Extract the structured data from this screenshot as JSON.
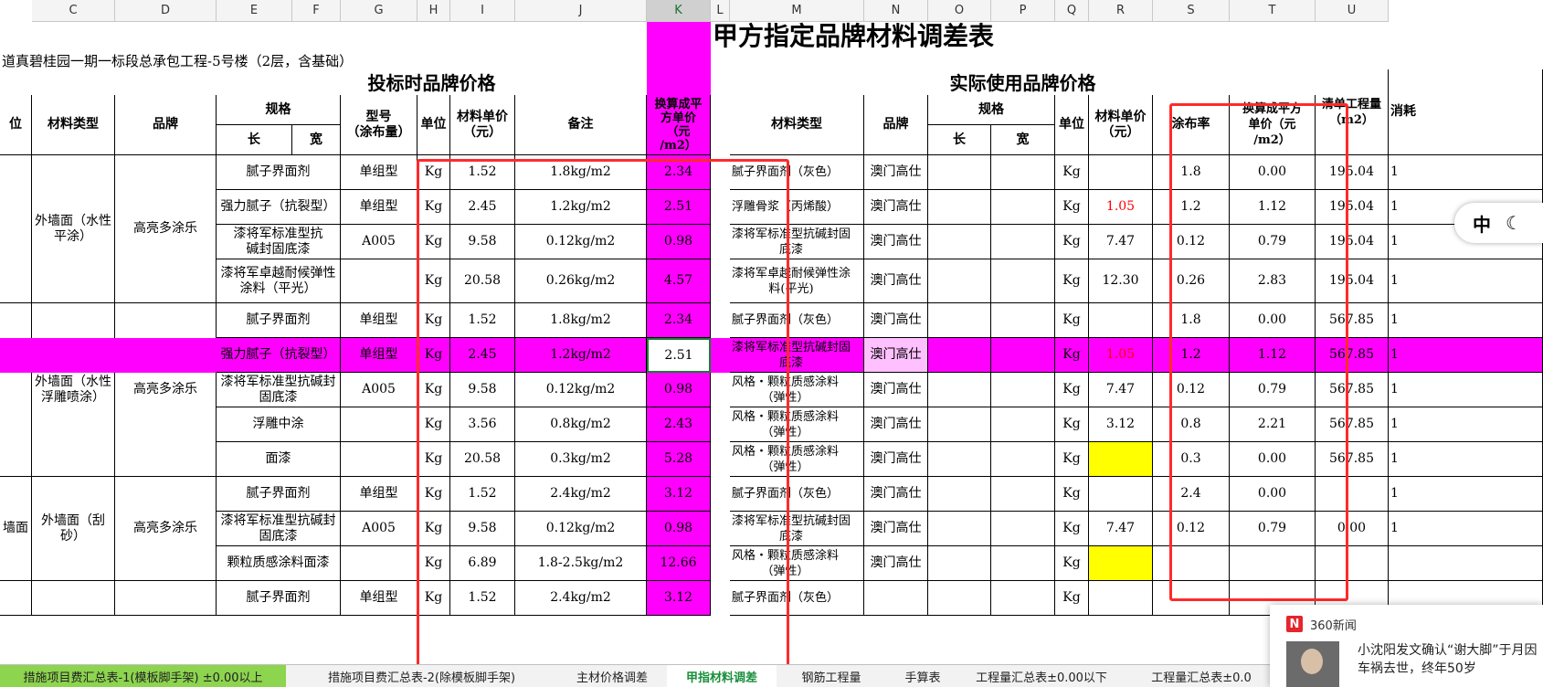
{
  "sheet": {
    "title": "甲方指定品牌材料调差表",
    "project": "道真碧桂园一期一标段总承包工程-5号楼（2层，含基础）",
    "section_left": "投标时品牌价格",
    "section_right": "实际使用品牌价格"
  },
  "column_letters": [
    "C",
    "D",
    "E",
    "F",
    "G",
    "H",
    "I",
    "J",
    "K",
    "L",
    "M",
    "N",
    "O",
    "P",
    "Q",
    "R",
    "S",
    "T",
    "U"
  ],
  "header": {
    "left_cut": "位",
    "material_type": "材料类型",
    "brand": "品牌",
    "spec": "规格",
    "length": "长",
    "width": "宽",
    "model": "型号\n（涂布量）",
    "unit": "单位",
    "unit_price": "材料单价\n（元）",
    "remark": "备注",
    "convert": "换算成平\n方单价\n（元\n/m2）",
    "coat_rate": "涂布率",
    "convert_r": "换算成平方\n单价（元\n/m2）",
    "quantity": "清单工程量\n（m2）",
    "consume_cut": "消耗"
  },
  "groups": [
    {
      "c": "",
      "material": "外墙面（水性\n平涂）",
      "brand": "高亮多涂乐"
    },
    {
      "c": "",
      "material": "外墙面（水性\n浮雕喷涂）",
      "brand": "高亮多涂乐"
    },
    {
      "c": "墙面",
      "material": "外墙面（刮\n砂）",
      "brand": "高亮多涂乐"
    }
  ],
  "rows": [
    {
      "e": "腻子界面剂",
      "g": "单组型",
      "h": "Kg",
      "i": "1.52",
      "j": "1.8kg/m2",
      "k": "2.34",
      "m": "腻子界面剂（灰色）",
      "n": "澳门高仕",
      "q": "Kg",
      "r": "",
      "s": "1.8",
      "t": "0.00",
      "u": "195.04",
      "v": "1"
    },
    {
      "e": "强力腻子（抗裂型）",
      "g": "单组型",
      "h": "Kg",
      "i": "2.45",
      "j": "1.2kg/m2",
      "k": "2.51",
      "m": "浮雕骨浆（丙烯酸）",
      "n": "澳门高仕",
      "q": "Kg",
      "r": "1.05",
      "s": "1.2",
      "t": "1.12",
      "u": "195.04",
      "v": "1"
    },
    {
      "e": "漆将军标准型抗\n碱封固底漆",
      "g": "A005",
      "h": "Kg",
      "i": "9.58",
      "j": "0.12kg/m2",
      "k": "0.98",
      "m": "漆将军标准型抗碱封固\n底漆",
      "n": "澳门高仕",
      "q": "Kg",
      "r": "7.47",
      "s": "0.12",
      "t": "0.79",
      "u": "195.04",
      "v": "1"
    },
    {
      "e": "漆将军卓越耐候弹性\n涂料（平光）",
      "g": "",
      "h": "Kg",
      "i": "20.58",
      "j": "0.26kg/m2",
      "k": "4.57",
      "m": "漆将军卓越耐候弹性涂\n料(平光)",
      "n": "澳门高仕",
      "q": "Kg",
      "r": "12.30",
      "s": "0.26",
      "t": "2.83",
      "u": "195.04",
      "v": "1"
    },
    {
      "e": "腻子界面剂",
      "g": "单组型",
      "h": "Kg",
      "i": "1.52",
      "j": "1.8kg/m2",
      "k": "2.34",
      "m": "腻子界面剂（灰色）",
      "n": "澳门高仕",
      "q": "Kg",
      "r": "",
      "s": "1.8",
      "t": "0.00",
      "u": "567.85",
      "v": "1"
    },
    {
      "e": "强力腻子（抗裂型）",
      "g": "单组型",
      "h": "Kg",
      "i": "2.45",
      "j": "1.2kg/m2",
      "k": "2.51",
      "m": "漆将军标准型抗碱封固\n底漆",
      "n": "澳门高仕",
      "q": "Kg",
      "r": "1.05",
      "s": "1.2",
      "t": "1.12",
      "u": "567.85",
      "v": "1"
    },
    {
      "e": "漆将军标准型抗碱封\n固底漆",
      "g": "A005",
      "h": "Kg",
      "i": "9.58",
      "j": "0.12kg/m2",
      "k": "0.98",
      "m": "风格・颗粒质感涂料\n（弹性）",
      "n": "澳门高仕",
      "q": "Kg",
      "r": "7.47",
      "s": "0.12",
      "t": "0.79",
      "u": "567.85",
      "v": "1"
    },
    {
      "e": "浮雕中涂",
      "g": "",
      "h": "Kg",
      "i": "3.56",
      "j": "0.8kg/m2",
      "k": "2.43",
      "m": "风格・颗粒质感涂料\n（弹性）",
      "n": "澳门高仕",
      "q": "Kg",
      "r": "3.12",
      "s": "0.8",
      "t": "2.21",
      "u": "567.85",
      "v": "1"
    },
    {
      "e": "面漆",
      "g": "",
      "h": "Kg",
      "i": "20.58",
      "j": "0.3kg/m2",
      "k": "5.28",
      "m": "风格・颗粒质感涂料\n（弹性）",
      "n": "澳门高仕",
      "q": "Kg",
      "r": "",
      "s": "0.3",
      "t": "0.00",
      "u": "567.85",
      "v": "1"
    },
    {
      "e": "腻子界面剂",
      "g": "单组型",
      "h": "Kg",
      "i": "1.52",
      "j": "2.4kg/m2",
      "k": "3.12",
      "m": "腻子界面剂（灰色）",
      "n": "澳门高仕",
      "q": "Kg",
      "r": "",
      "s": "2.4",
      "t": "0.00",
      "u": "",
      "v": "1"
    },
    {
      "e": "漆将军标准型抗碱封\n固底漆",
      "g": "A005",
      "h": "Kg",
      "i": "9.58",
      "j": "0.12kg/m2",
      "k": "0.98",
      "m": "漆将军标准型抗碱封固\n底漆",
      "n": "澳门高仕",
      "q": "Kg",
      "r": "7.47",
      "s": "0.12",
      "t": "0.79",
      "u": "0.00",
      "v": "1"
    },
    {
      "e": "颗粒质感涂料面漆",
      "g": "",
      "h": "Kg",
      "i": "6.89",
      "j": "1.8-2.5kg/m2",
      "k": "12.66",
      "m": "风格・颗粒质感涂料\n（弹性）",
      "n": "澳门高仕",
      "q": "Kg",
      "r": "",
      "s": "",
      "t": "",
      "u": "",
      "v": ""
    },
    {
      "e": "腻子界面剂",
      "g": "单组型",
      "h": "Kg",
      "i": "1.52",
      "j": "2.4kg/m2",
      "k": "3.12",
      "m": "腻子界面剂（灰色）",
      "n": "",
      "q": "Kg",
      "r": "",
      "s": "",
      "t": "",
      "u": "",
      "v": ""
    }
  ],
  "colors": {
    "magenta": "#ff00ff",
    "pink_cell": "#ffc0ff",
    "yellow": "#ffff00",
    "red_text": "#ff0000",
    "highlight_box": "#ff2a2a"
  },
  "tabs": [
    "措施项目费汇总表-1(模板脚手架) ±0.00以上",
    "措施项目费汇总表-2(除模板脚手架)",
    "主材价格调差",
    "甲指材料调差",
    "钢筋工程量",
    "手算表",
    "工程量汇总表±0.00以下",
    "工程量汇总表±0.0"
  ],
  "ime": {
    "label": "中"
  },
  "news": {
    "source": "360新闻",
    "headline": "小沈阳发文确认“谢大脚”于月因车祸去世，终年50岁"
  }
}
